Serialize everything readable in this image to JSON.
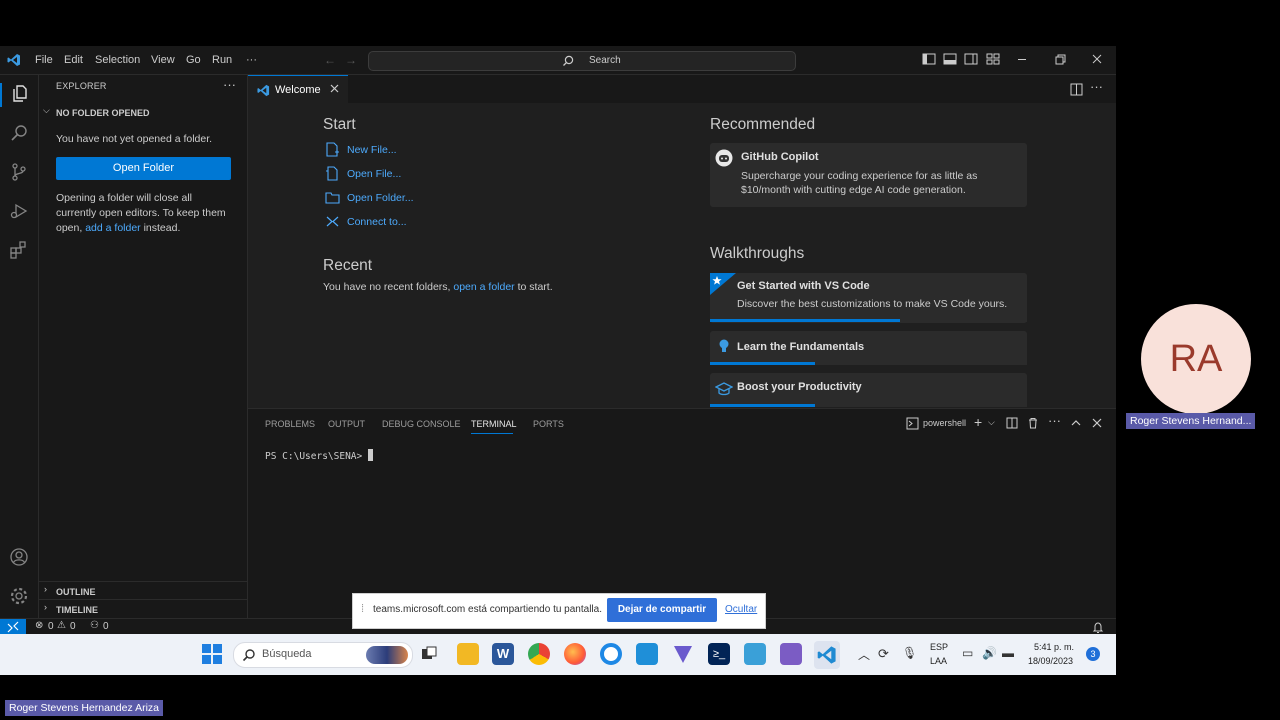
{
  "menu": [
    "File",
    "Edit",
    "Selection",
    "View",
    "Go",
    "Run",
    "···"
  ],
  "search": {
    "label": "Search"
  },
  "explorer": {
    "title": "EXPLORER",
    "section": "NO FOLDER OPENED",
    "no_folder_text": "You have not yet opened a folder.",
    "open_folder_button": "Open Folder",
    "hint_line1": "Opening a folder will close all",
    "hint_line2": "currently open editors. To keep them",
    "hint_line3_pre": "open,",
    "hint_link": "add a folder",
    "hint_line3_post": "instead.",
    "outline": "OUTLINE",
    "timeline": "TIMELINE"
  },
  "tab": {
    "label": "Welcome"
  },
  "welcome": {
    "start_heading": "Start",
    "start_items": [
      "New File...",
      "Open File...",
      "Open Folder...",
      "Connect to..."
    ],
    "recent_heading": "Recent",
    "recent_text_pre": "You have no recent folders,",
    "recent_link": "open a folder",
    "recent_text_post": "to start.",
    "recommended_heading": "Recommended",
    "copilot_title": "GitHub Copilot",
    "copilot_desc1": "Supercharge your coding experience for as little as",
    "copilot_desc2": "$10/month with cutting edge AI code generation.",
    "walkthroughs_heading": "Walkthroughs",
    "walkthroughs": [
      {
        "title": "Get Started with VS Code",
        "desc": "Discover the best customizations to make VS Code yours.",
        "progress": 0.6
      },
      {
        "title": "Learn the Fundamentals",
        "progress": 0.33
      },
      {
        "title": "Boost your Productivity",
        "progress": 0.33
      }
    ]
  },
  "panel": {
    "tabs": [
      "PROBLEMS",
      "OUTPUT",
      "DEBUG CONSOLE",
      "TERMINAL",
      "PORTS"
    ],
    "active_tab": "TERMINAL",
    "shell": "powershell",
    "prompt": "PS C:\\Users\\SENA>"
  },
  "status": {
    "errors": "0",
    "warnings": "0",
    "ports": "0"
  },
  "share_bar": {
    "text": "teams.microsoft.com está compartiendo tu pantalla.",
    "stop_button": "Dejar de compartir",
    "hide_link": "Ocultar"
  },
  "taskbar": {
    "search_placeholder": "Búsqueda",
    "lang_top": "ESP",
    "lang_bottom": "LAA",
    "time": "5:41 p. m.",
    "date": "18/09/2023",
    "notification_count": "3"
  },
  "participant": {
    "initials": "RA",
    "name_short": "Roger Stevens Hernand...",
    "name_full": "Roger Stevens Hernandez Ariza"
  },
  "colors": {
    "accent": "#0078d4",
    "link": "#4daafc",
    "avatar_bg": "#f9e1da",
    "avatar_fg": "#9a3a2c",
    "name_tag": "#5a5aa8"
  }
}
